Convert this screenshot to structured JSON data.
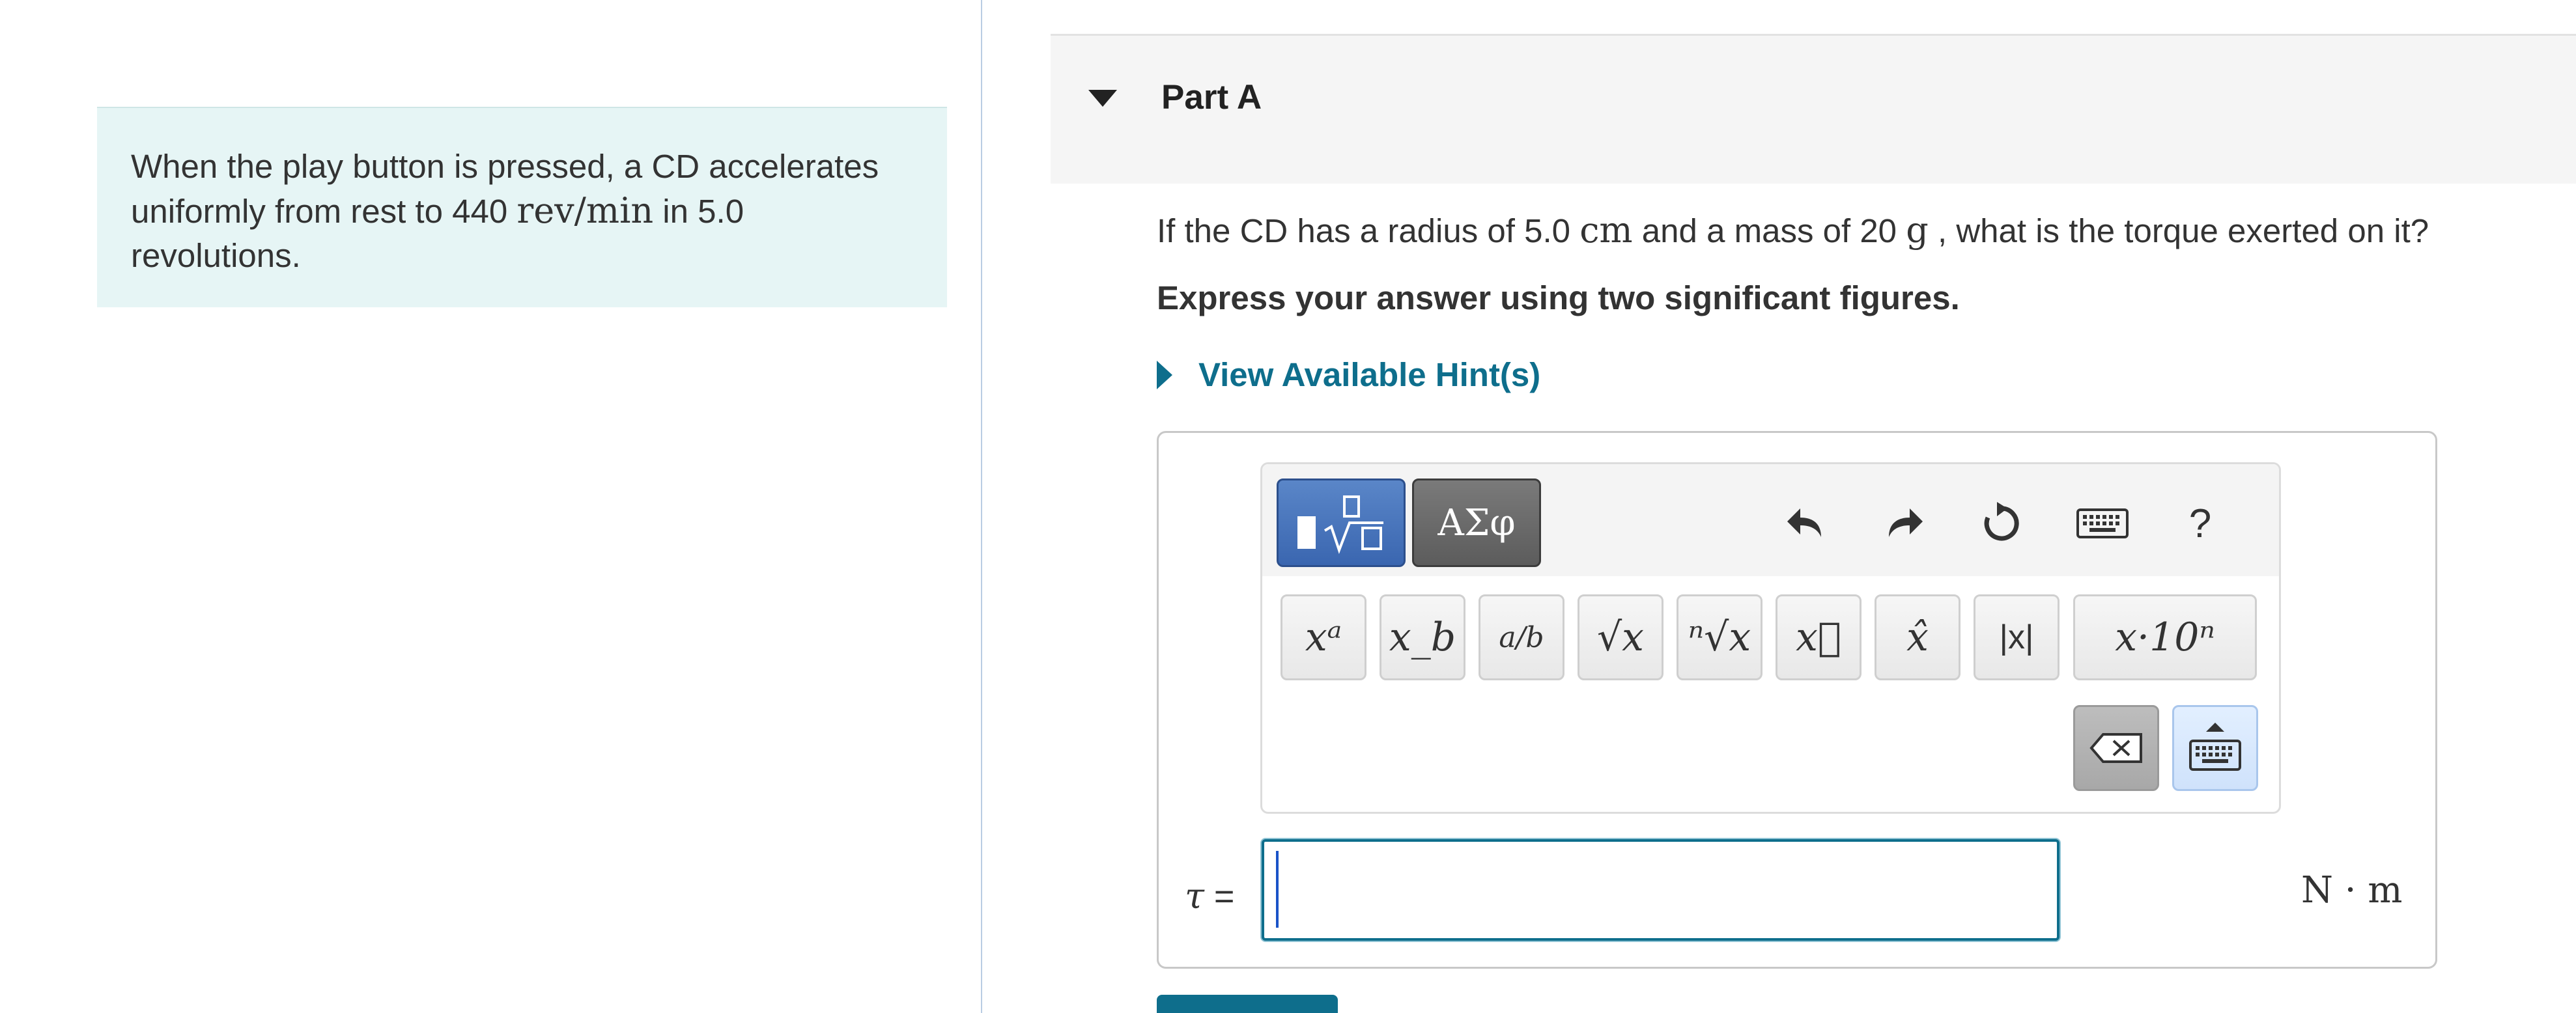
{
  "intro": {
    "text_before": "When the play button is pressed, a CD accelerates uniformly from rest to 440 ",
    "math_unit": "rev/min",
    "text_after": " in 5.0 revolutions."
  },
  "part": {
    "title": "Part A"
  },
  "question": {
    "text_1": "If the CD has a radius of 5.0 ",
    "unit_cm": "cm",
    "text_2": " and a mass of 20 ",
    "unit_g": "g",
    "text_3": " , what is the torque exerted on it?"
  },
  "instruction": "Express your answer using two significant figures.",
  "hints_label": "View Available Hint(s)",
  "toolbar": {
    "symbols_label": "ΑΣφ",
    "help_label": "?",
    "templates": [
      {
        "name": "superscript",
        "label": "xᵃ"
      },
      {
        "name": "subscript",
        "label": "x_b"
      },
      {
        "name": "fraction",
        "label": "a/b"
      },
      {
        "name": "sqrt",
        "label": "√x"
      },
      {
        "name": "nth-root",
        "label": "ⁿ√x"
      },
      {
        "name": "vector",
        "label": "x⃗"
      },
      {
        "name": "unit-vector",
        "label": "x̂"
      },
      {
        "name": "absolute",
        "label": "|x|"
      },
      {
        "name": "sci-notation",
        "label": "x·10ⁿ"
      }
    ]
  },
  "answer": {
    "variable": "τ",
    "equals": "=",
    "value": "",
    "units": "N · m"
  }
}
